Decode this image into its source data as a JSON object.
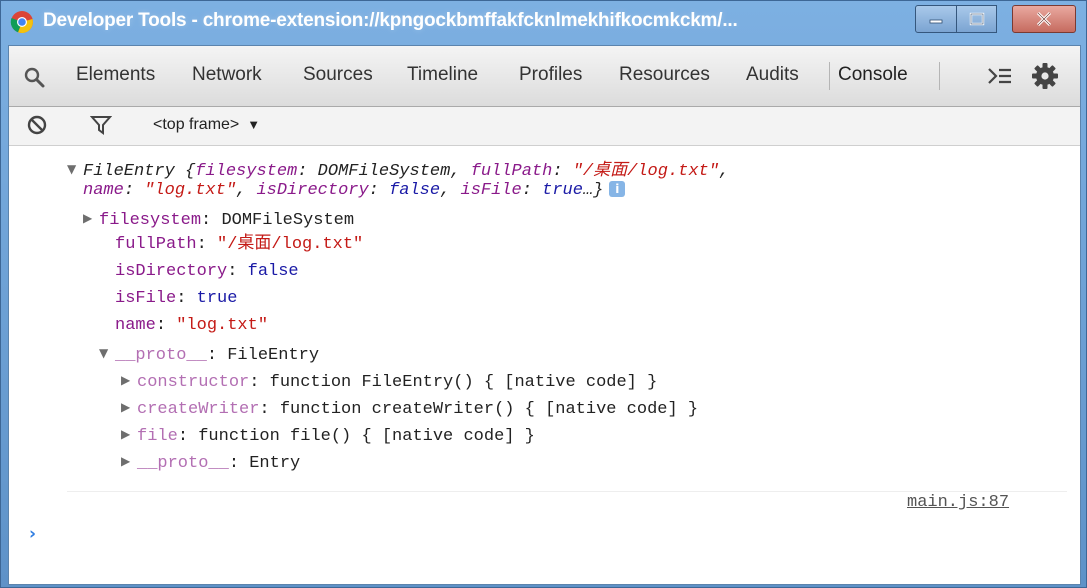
{
  "window": {
    "title": "Developer Tools - chrome-extension://kpngockbmffakfcknlmekhifkocmkckm/...",
    "controls": {
      "minimize": "minimize",
      "maximize": "maximize",
      "close": "close"
    }
  },
  "tabs": [
    {
      "label": "Elements"
    },
    {
      "label": "Network"
    },
    {
      "label": "Sources"
    },
    {
      "label": "Timeline"
    },
    {
      "label": "Profiles"
    },
    {
      "label": "Resources"
    },
    {
      "label": "Audits"
    },
    {
      "label": "Console",
      "active": true
    }
  ],
  "toolbar": {
    "frame": "<top frame>",
    "frame_arrow": "▼"
  },
  "console": {
    "summary": {
      "type": "FileEntry",
      "open_brace": " {",
      "k1": "filesystem",
      "v1": "DOMFileSystem",
      "k2": "fullPath",
      "v2": "\"/桌面/log.txt\"",
      "k3": "name",
      "v3": "\"log.txt\"",
      "k4": "isDirectory",
      "v4": "false",
      "k5": "isFile",
      "v5": "true",
      "ellipsis": "…}",
      "info": "i"
    },
    "props": [
      {
        "key": "filesystem",
        "value": "DOMFileSystem"
      },
      {
        "key": "fullPath",
        "value": "\"/桌面/log.txt\""
      },
      {
        "key": "isDirectory",
        "value": "false"
      },
      {
        "key": "isFile",
        "value": "true"
      },
      {
        "key": "name",
        "value": "\"log.txt\""
      },
      {
        "key": "__proto__",
        "value": "FileEntry"
      }
    ],
    "proto_props": [
      {
        "key": "constructor",
        "value": "function FileEntry() { [native code] }"
      },
      {
        "key": "createWriter",
        "value": "function createWriter() { [native code] }"
      },
      {
        "key": "file",
        "value": "function file() { [native code] }"
      },
      {
        "key": "__proto__",
        "value": "Entry"
      }
    ],
    "source": "main.js:87",
    "prompt": "›"
  },
  "colors": {
    "title_bar": "#6f9fcf",
    "property_name": "#8a1a8a",
    "string_value": "#c41a16",
    "prompt": "#2f7de1"
  },
  "icons": {
    "app": "chrome-icon",
    "search": "search-icon",
    "drawer": "drawer-icon",
    "settings": "gear-icon",
    "clear": "clear-console-icon",
    "filter": "filter-icon"
  }
}
